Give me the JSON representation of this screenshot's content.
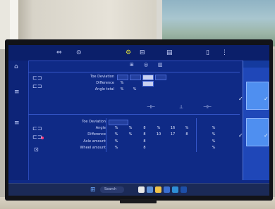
{
  "toolbar": {
    "icons": [
      "wheel-alignment-icon",
      "steering-icon",
      "settings-gear-icon",
      "vehicle-icon",
      "printer-icon",
      "document-icon",
      "menu-icon"
    ],
    "active": "settings-gear-icon"
  },
  "sections": {
    "front": {
      "header_icons": [
        "left-wheel-icon",
        "target-icon",
        "clipboard-icon"
      ],
      "rows": [
        {
          "label": "Toe Deviation",
          "values": [
            "",
            "",
            "",
            ""
          ]
        },
        {
          "label": "Difference",
          "values": [
            "%",
            "",
            "",
            ""
          ]
        },
        {
          "label": "Angle total",
          "values": [
            "%",
            "%",
            "",
            ""
          ]
        }
      ]
    },
    "rear": {
      "header_icons": [
        "left-wheel-icon",
        "axle-icon",
        "right-wheel-icon"
      ],
      "rows": [
        {
          "label": "Toe Deviation",
          "values": [
            "",
            "",
            "",
            "",
            "",
            "",
            "",
            ""
          ]
        },
        {
          "label": "Angle",
          "values": [
            "%",
            "%",
            "8",
            "%",
            "16",
            "%",
            "",
            "%"
          ]
        },
        {
          "label": "Difference",
          "values": [
            "%",
            "%",
            "8",
            "10",
            "17",
            "8",
            "",
            "%"
          ]
        },
        {
          "label": "Axle amount",
          "values": [
            "%",
            "",
            "8",
            "",
            "",
            "",
            "",
            "%"
          ]
        },
        {
          "label": "Wheel amount",
          "values": [
            "%",
            "",
            "8",
            "",
            "",
            "",
            "",
            "%"
          ]
        }
      ]
    }
  },
  "right_panel": {
    "header": "",
    "labels": [
      "",
      ""
    ]
  },
  "taskbar": {
    "search_placeholder": "Search",
    "tray_text": "",
    "left_text": ""
  },
  "colors": {
    "screen_bg": "#0f2a86",
    "accent": "#e3e23a",
    "panel_blue": "#4f8ff0",
    "marker": "#ff3a7c"
  }
}
